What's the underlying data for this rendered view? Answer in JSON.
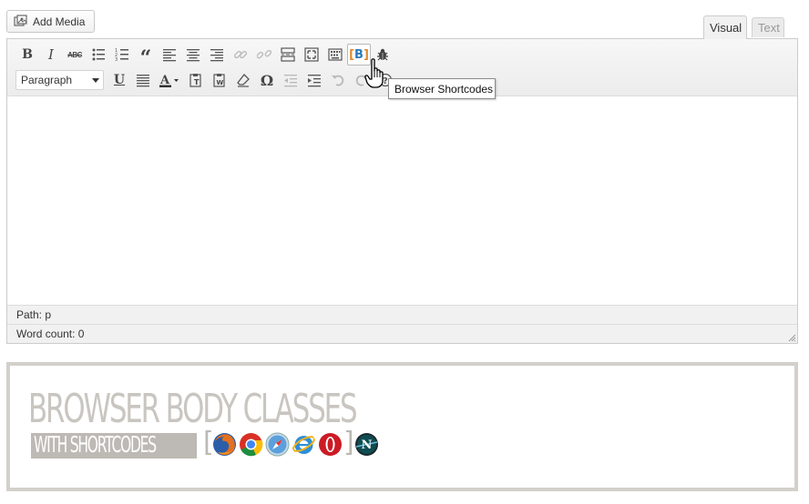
{
  "add_media": {
    "label": "Add Media"
  },
  "tabs": {
    "visual": "Visual",
    "text": "Text"
  },
  "toolbar": {
    "row1": [
      {
        "name": "bold",
        "icon": "bold-icon"
      },
      {
        "name": "italic",
        "icon": "italic-icon"
      },
      {
        "name": "strikethrough",
        "icon": "strikethrough-icon"
      },
      {
        "name": "bullet-list",
        "icon": "bullet-list-icon"
      },
      {
        "name": "numbered-list",
        "icon": "numbered-list-icon"
      },
      {
        "name": "blockquote",
        "icon": "blockquote-icon"
      },
      {
        "name": "align-left",
        "icon": "align-left-icon"
      },
      {
        "name": "align-center",
        "icon": "align-center-icon"
      },
      {
        "name": "align-right",
        "icon": "align-right-icon"
      },
      {
        "name": "insert-link",
        "icon": "link-icon",
        "disabled": true
      },
      {
        "name": "remove-link",
        "icon": "unlink-icon",
        "disabled": true
      },
      {
        "name": "insert-more",
        "icon": "more-tag-icon"
      },
      {
        "name": "fullscreen",
        "icon": "fullscreen-icon"
      },
      {
        "name": "toolbar-toggle",
        "icon": "kitchen-sink-icon"
      },
      {
        "name": "browser-shortcodes",
        "icon": "browser-shortcodes-icon",
        "active": true
      },
      {
        "name": "bug",
        "icon": "bug-icon"
      }
    ],
    "format_select": {
      "value": "Paragraph"
    },
    "brand_colors": {
      "bracket": "#e08a2c",
      "letter": "#2a7ab8"
    }
  },
  "tooltip": {
    "text": "Browser Shortcodes"
  },
  "status": {
    "path": "Path: p",
    "word_count": "Word count: 0"
  },
  "banner": {
    "title": "BROWSER BODY CLASSES",
    "subtitle": "WITH SHORTCODES",
    "browser_icons": [
      "firefox-icon",
      "chrome-icon",
      "safari-icon",
      "internet-explorer-icon",
      "opera-icon",
      "netscape-icon"
    ]
  }
}
